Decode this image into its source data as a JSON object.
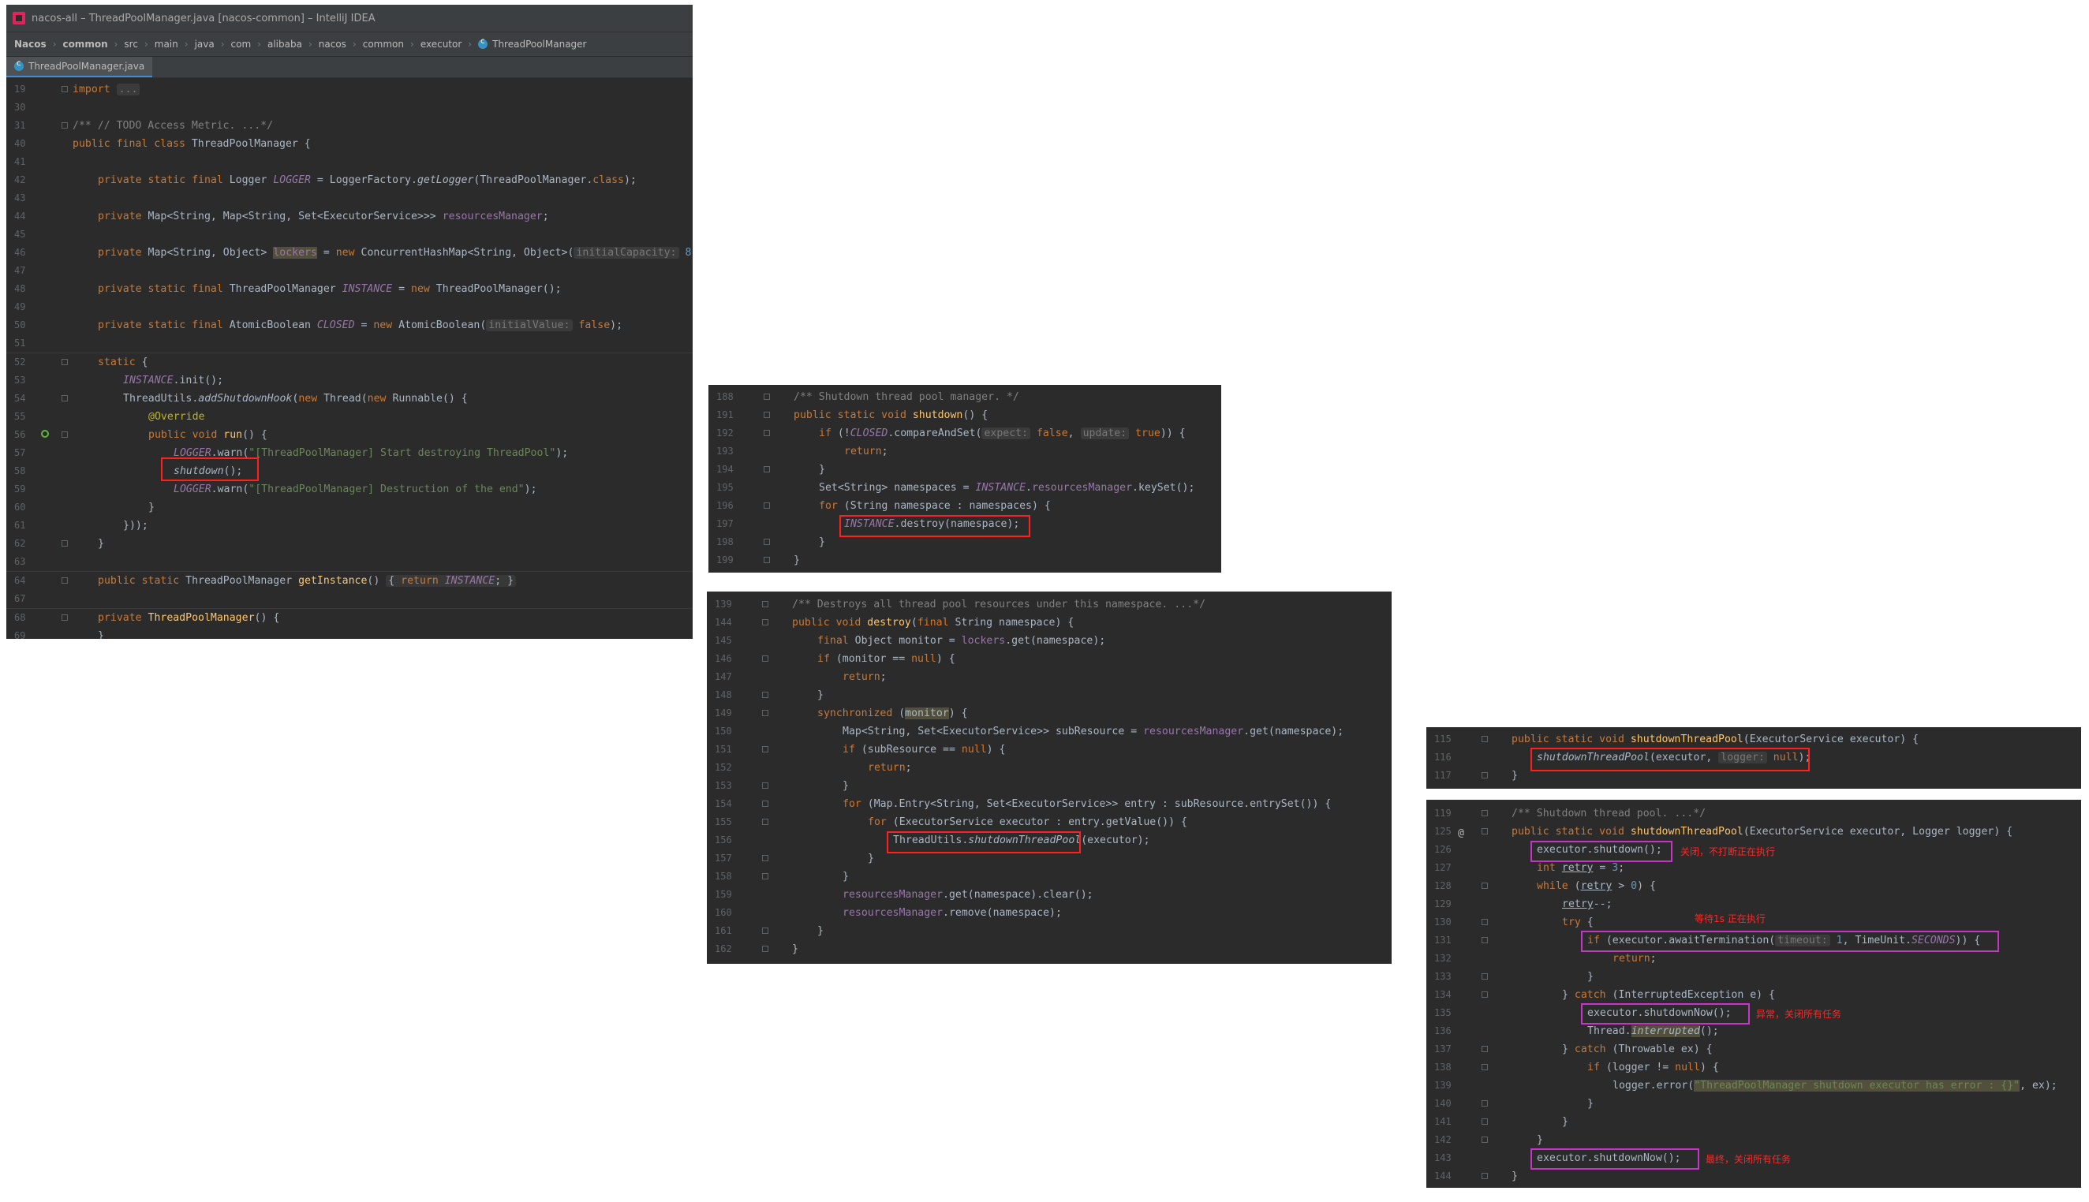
{
  "window": {
    "title": "nacos-all – ThreadPoolManager.java [nacos-common] – IntelliJ IDEA",
    "breadcrumbs": [
      "Nacos",
      "common",
      "src",
      "main",
      "java",
      "com",
      "alibaba",
      "nacos",
      "common",
      "executor",
      "ThreadPoolManager"
    ],
    "tab_label": "ThreadPoolManager.java"
  },
  "colors": {
    "editor_bg": "#2b2b2b",
    "keyword": "#cc7832",
    "field": "#9876aa",
    "string": "#6a8759",
    "number": "#6897bb",
    "comment": "#808080",
    "method": "#ffc66d",
    "highlight_red": "#ff2020",
    "highlight_purple": "#c437c4"
  },
  "panel1": {
    "line_numbers": [
      "19",
      "30",
      "31",
      "40",
      "41",
      "42",
      "43",
      "44",
      "45",
      "46",
      "47",
      "48",
      "49",
      "50",
      "51",
      "52",
      "53",
      "54",
      "55",
      "56",
      "57",
      "58",
      "59",
      "60",
      "61",
      "62",
      "63",
      "64",
      "67",
      "68",
      "69"
    ],
    "code": {
      "import_kw": "import",
      "import_folded": "...",
      "todo_comment": "/** // TODO Access Metric. ...*/",
      "class_decl_a": "public final class ",
      "class_decl_b": "ThreadPoolManager {",
      "logger_a": "private static final ",
      "logger_b": "Logger ",
      "logger_c": "LOGGER",
      "logger_d": " = LoggerFactory.",
      "logger_e": "getLogger",
      "logger_f": "(ThreadPoolManager.",
      "logger_g": "class",
      "logger_h": ");",
      "res_a": "private ",
      "res_b": "Map<String, Map<String, Set<ExecutorService>>> ",
      "res_c": "resourcesManager",
      "res_d": ";",
      "lock_a": "private ",
      "lock_b": "Map<String, Object> ",
      "lock_c": "lockers",
      "lock_d": " = ",
      "lock_e": "new ",
      "lock_f": "ConcurrentHashMap<String, Object>(",
      "lock_hint": "initialCapacity:",
      "lock_num": " 8",
      "lock_end": ");",
      "inst_a": "private static final ",
      "inst_b": "ThreadPoolManager ",
      "inst_c": "INSTANCE",
      "inst_d": " = ",
      "inst_e": "new ",
      "inst_f": "ThreadPoolManager();",
      "closed_a": "private static final ",
      "closed_b": "AtomicBoolean ",
      "closed_c": "CLOSED",
      "closed_d": " = ",
      "closed_e": "new ",
      "closed_f": "AtomicBoolean(",
      "closed_hint": "initialValue:",
      "closed_g": " false",
      "closed_h": ");",
      "static_kw": "static ",
      "static_b": "{",
      "init_a": "INSTANCE",
      "init_b": ".init();",
      "hook_a": "ThreadUtils.",
      "hook_b": "addShutdownHook",
      "hook_c": "(",
      "hook_d": "new ",
      "hook_e": "Thread(",
      "hook_f": "new ",
      "hook_g": "Runnable() {",
      "override": "@Override",
      "run_a": "public void ",
      "run_b": "run",
      "run_c": "() {",
      "warn1_a": "LOGGER",
      "warn1_b": ".warn(",
      "warn1_c": "\"[ThreadPoolManager] Start destroying ThreadPool\"",
      "warn1_d": ");",
      "shutdown_call": "shutdown",
      "shutdown_end": "();",
      "warn2_a": "LOGGER",
      "warn2_b": ".warn(",
      "warn2_c": "\"[ThreadPoolManager] Destruction of the end\"",
      "warn2_d": ");",
      "close_brace1": "}",
      "close_hook": "}));",
      "close_brace2": "}",
      "getinst_a": "public static ",
      "getinst_b": "ThreadPoolManager ",
      "getinst_c": "getInstance",
      "getinst_d": "() ",
      "getinst_e": "{ ",
      "getinst_f": "return ",
      "getinst_g": "INSTANCE",
      "getinst_h": "; }",
      "ctor_a": "private ",
      "ctor_b": "ThreadPoolManager",
      "ctor_c": "() {",
      "close_brace3": "}"
    }
  },
  "panel2": {
    "line_numbers": [
      "188",
      "191",
      "192",
      "193",
      "194",
      "195",
      "196",
      "197",
      "198",
      "199"
    ],
    "code": {
      "comment": "/** Shutdown thread pool manager. */",
      "decl_a": "public static void ",
      "decl_b": "shutdown",
      "decl_c": "() {",
      "if_a": "if ",
      "if_b": "(!",
      "if_c": "CLOSED",
      "if_d": ".compareAndSet(",
      "if_hint1": "expect:",
      "if_e": " false",
      "if_f": ", ",
      "if_hint2": "update:",
      "if_g": " true",
      "if_h": ")) {",
      "ret": "return",
      "ret_end": ";",
      "brace1": "}",
      "set_a": "Set<String> namespaces = ",
      "set_b": "INSTANCE",
      "set_c": ".",
      "set_d": "resourcesManager",
      "set_e": ".keySet();",
      "for_a": "for ",
      "for_b": "(String namespace : namespaces) {",
      "destroy_a": "INSTANCE",
      "destroy_b": ".destroy(namespace);",
      "brace2": "}",
      "brace3": "}"
    }
  },
  "panel3": {
    "line_numbers": [
      "139",
      "144",
      "145",
      "146",
      "147",
      "148",
      "149",
      "150",
      "151",
      "152",
      "153",
      "154",
      "155",
      "156",
      "157",
      "158",
      "159",
      "160",
      "161",
      "162"
    ],
    "code": {
      "comment": "/** Destroys all thread pool resources under this namespace. ...*/",
      "decl_a": "public void ",
      "decl_b": "destroy",
      "decl_c": "(",
      "decl_d": "final ",
      "decl_e": "String namespace) {",
      "mon_a": "final ",
      "mon_b": "Object monitor = ",
      "mon_c": "lockers",
      "mon_d": ".get(namespace);",
      "if_a": "if ",
      "if_b": "(monitor == ",
      "if_c": "null",
      "if_d": ") {",
      "ret1": "return",
      "ret1_end": ";",
      "brace1": "}",
      "sync_a": "synchronized ",
      "sync_b": "(",
      "sync_c": "monitor",
      "sync_d": ") {",
      "map_a": "Map<String, Set<ExecutorService>> subResource = ",
      "map_b": "resourcesManager",
      "map_c": ".get(namespace);",
      "if2_a": "if ",
      "if2_b": "(subResource == ",
      "if2_c": "null",
      "if2_d": ") {",
      "ret2": "return",
      "ret2_end": ";",
      "brace2": "}",
      "for1_a": "for ",
      "for1_b": "(Map.Entry<String, Set<ExecutorService>> entry : subResource.entrySet()) {",
      "for2_a": "for ",
      "for2_b": "(ExecutorService executor : entry.getValue()) {",
      "call_a": "ThreadUtils.",
      "call_b": "shutdownThreadPool",
      "call_c": "(executor);",
      "brace3": "}",
      "brace4": "}",
      "clear_a": "resourcesManager",
      "clear_b": ".get(namespace).clear();",
      "remove_a": "resourcesManager",
      "remove_b": ".remove(namespace);",
      "brace5": "}",
      "brace6": "}"
    }
  },
  "panel4": {
    "line_numbers": [
      "115",
      "116",
      "117"
    ],
    "code": {
      "decl_a": "public static void ",
      "decl_b": "shutdownThreadPool",
      "decl_c": "(ExecutorService executor) {",
      "call_a": "shutdownThreadPool",
      "call_b": "(executor, ",
      "call_hint": "logger:",
      "call_c": " null",
      "call_d": ");",
      "brace": "}"
    }
  },
  "panel5": {
    "line_numbers": [
      "119",
      "125",
      "126",
      "127",
      "128",
      "129",
      "130",
      "131",
      "132",
      "133",
      "134",
      "135",
      "136",
      "137",
      "138",
      "139",
      "140",
      "141",
      "142",
      "143",
      "144"
    ],
    "code": {
      "comment": "/** Shutdown thread pool. ...*/",
      "decl_a": "public static void ",
      "decl_b": "shutdownThreadPool",
      "decl_c": "(ExecutorService executor, Logger logger) {",
      "sd": "executor.shutdown();",
      "int_a": "int ",
      "int_b": "retry",
      "int_c": " = ",
      "int_d": "3",
      "int_e": ";",
      "while_a": "while ",
      "while_b": "(",
      "while_c": "retry",
      "while_d": " > ",
      "while_e": "0",
      "while_f": ") {",
      "dec_a": "retry",
      "dec_b": "--;",
      "try_a": "try ",
      "try_b": "{",
      "await_a": "if ",
      "await_b": "(executor.awaitTermination(",
      "await_hint": "timeout:",
      "await_c": " 1",
      "await_d": ", TimeUnit.",
      "await_e": "SECONDS",
      "await_f": ")) {",
      "ret": "return",
      "ret_end": ";",
      "brace1": "}",
      "catch1_a": "} ",
      "catch1_b": "catch ",
      "catch1_c": "(InterruptedException e) {",
      "now1": "executor.shutdownNow();",
      "int2_a": "Thread.",
      "int2_b": "interrupted",
      "int2_c": "();",
      "catch2_a": "} ",
      "catch2_b": "catch ",
      "catch2_c": "(Throwable ex) {",
      "iflog_a": "if ",
      "iflog_b": "(logger != ",
      "iflog_c": "null",
      "iflog_d": ") {",
      "err_a": "logger.error(",
      "err_b": "\"ThreadPoolManager shutdown executor has error : {}\"",
      "err_c": ", ex);",
      "brace2": "}",
      "brace3": "}",
      "brace4": "}",
      "now2": "executor.shutdownNow();",
      "brace5": "}"
    },
    "notes": {
      "n1": "关闭，不打断正在执行",
      "n2": "等待1s 正在执行",
      "n3": "异常，关闭所有任务",
      "n4": "最终，关闭所有任务"
    }
  }
}
